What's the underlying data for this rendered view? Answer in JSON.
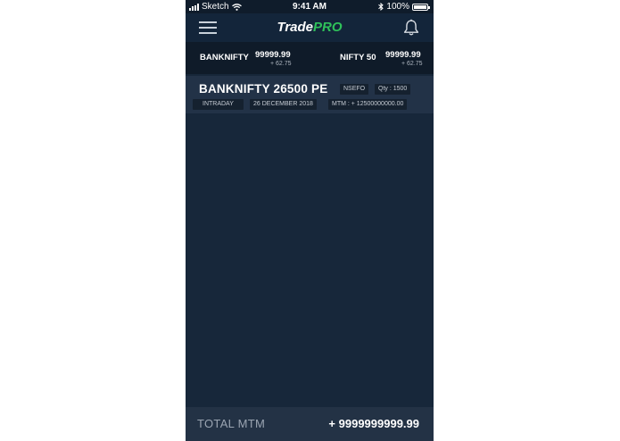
{
  "status_bar": {
    "carrier": "Sketch",
    "time": "9:41 AM",
    "battery": "100%"
  },
  "nav": {
    "brand_trade": "Trade",
    "brand_pro": "PRO"
  },
  "ticker": [
    {
      "name": "BANKNIFTY",
      "value": "99999.99",
      "change": "+ 62.75"
    },
    {
      "name": "NIFTY 50",
      "value": "99999.99",
      "change": "+ 62.75"
    }
  ],
  "position": {
    "title": "BANKNIFTY 26500 PE",
    "exchange": "NSEFO",
    "qty": "Qty : 1500",
    "product": "INTRADAY",
    "date": "26 DECEMBER 2018",
    "mtm": "MTM : + 12500000000.00"
  },
  "footer": {
    "label": "TOTAL MTM",
    "value": "+ 9999999999.99"
  },
  "colors": {
    "background": "#17273a",
    "accent": "#2fc15a",
    "footer": "#233245"
  }
}
